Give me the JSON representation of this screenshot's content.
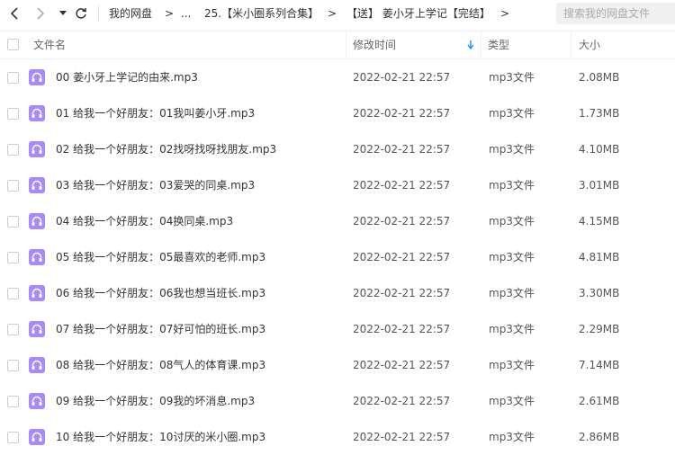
{
  "breadcrumb": {
    "root": "我的网盘",
    "ellipsis": "...",
    "folder1": "25.【米小圈系列合集】",
    "folder2": "【送】 姜小牙上学记【完结】",
    "sep": ">"
  },
  "search": {
    "placeholder": "搜索我的网盘文件"
  },
  "columns": {
    "name": "文件名",
    "modified": "修改时间",
    "type": "类型",
    "size": "大小"
  },
  "colors": {
    "icon_bg": "#a78bfa",
    "sort_arrow": "#1a8cff"
  },
  "rows": [
    {
      "name": "00 姜小牙上学记的由来.mp3",
      "modified": "2022-02-21 22:57",
      "type": "mp3文件",
      "size": "2.08MB"
    },
    {
      "name": "01 给我一个好朋友：01我叫姜小牙.mp3",
      "modified": "2022-02-21 22:57",
      "type": "mp3文件",
      "size": "1.73MB"
    },
    {
      "name": "02 给我一个好朋友：02找呀找呀找朋友.mp3",
      "modified": "2022-02-21 22:57",
      "type": "mp3文件",
      "size": "4.10MB"
    },
    {
      "name": "03 给我一个好朋友：03爱哭的同桌.mp3",
      "modified": "2022-02-21 22:57",
      "type": "mp3文件",
      "size": "3.01MB"
    },
    {
      "name": "04 给我一个好朋友：04换同桌.mp3",
      "modified": "2022-02-21 22:57",
      "type": "mp3文件",
      "size": "4.15MB"
    },
    {
      "name": "05 给我一个好朋友：05最喜欢的老师.mp3",
      "modified": "2022-02-21 22:57",
      "type": "mp3文件",
      "size": "4.81MB"
    },
    {
      "name": "06 给我一个好朋友：06我也想当班长.mp3",
      "modified": "2022-02-21 22:57",
      "type": "mp3文件",
      "size": "3.30MB"
    },
    {
      "name": "07 给我一个好朋友：07好可怕的班长.mp3",
      "modified": "2022-02-21 22:57",
      "type": "mp3文件",
      "size": "2.29MB"
    },
    {
      "name": "08 给我一个好朋友：08气人的体育课.mp3",
      "modified": "2022-02-21 22:57",
      "type": "mp3文件",
      "size": "7.14MB"
    },
    {
      "name": "09 给我一个好朋友：09我的坏消息.mp3",
      "modified": "2022-02-21 22:57",
      "type": "mp3文件",
      "size": "2.61MB"
    },
    {
      "name": "10 给我一个好朋友：10讨厌的米小圈.mp3",
      "modified": "2022-02-21 22:57",
      "type": "mp3文件",
      "size": "2.86MB"
    }
  ]
}
